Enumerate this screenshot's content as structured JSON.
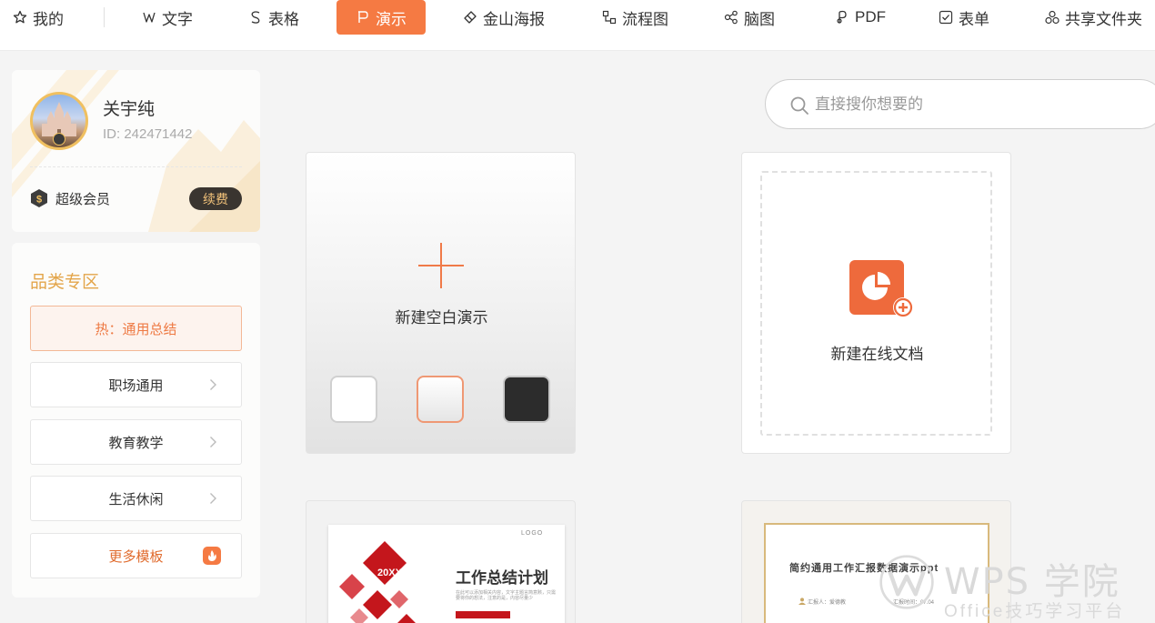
{
  "nav": {
    "items": [
      {
        "label": "我的",
        "icon": "star-icon"
      },
      {
        "label": "文字",
        "icon": "word-icon"
      },
      {
        "label": "表格",
        "icon": "spreadsheet-icon"
      },
      {
        "label": "演示",
        "icon": "presentation-icon",
        "active": true
      },
      {
        "label": "金山海报",
        "icon": "poster-icon"
      },
      {
        "label": "流程图",
        "icon": "flowchart-icon"
      },
      {
        "label": "脑图",
        "icon": "mindmap-icon"
      },
      {
        "label": "PDF",
        "icon": "pdf-icon"
      },
      {
        "label": "表单",
        "icon": "form-icon"
      },
      {
        "label": "共享文件夹",
        "icon": "shared-folder-icon"
      }
    ]
  },
  "profile": {
    "name": "关宇纯",
    "id_text": "ID: 242471442",
    "member_label": "超级会员",
    "renew_label": "续费"
  },
  "categories": {
    "title": "品类专区",
    "items": [
      {
        "label": "热：通用总结",
        "hot": true
      },
      {
        "label": "职场通用"
      },
      {
        "label": "教育教学"
      },
      {
        "label": "生活休闲"
      },
      {
        "label": "更多模板",
        "more": true
      }
    ]
  },
  "search": {
    "placeholder": "直接搜你想要的"
  },
  "cards": {
    "blank_label": "新建空白演示",
    "online_label": "新建在线文档"
  },
  "templates": {
    "t1_logo": "LOGO",
    "t1_year": "20XX",
    "t1_title": "工作总结计划",
    "t1_sub": "在此可以添加相关内容，文字主题言简意赅，只需要将你的想法，注意的是，内容尽量少",
    "t2_title": "简约通用工作汇报数据演示ppt",
    "t2_meta1": "汇报人：爱德教",
    "t2_meta2": "汇报时间：07.04"
  },
  "watermark": {
    "title": "WPS 学院",
    "subtitle": "Office技巧学习平台"
  },
  "colors": {
    "accent": "#f57a43",
    "gold": "#e3a54a"
  }
}
